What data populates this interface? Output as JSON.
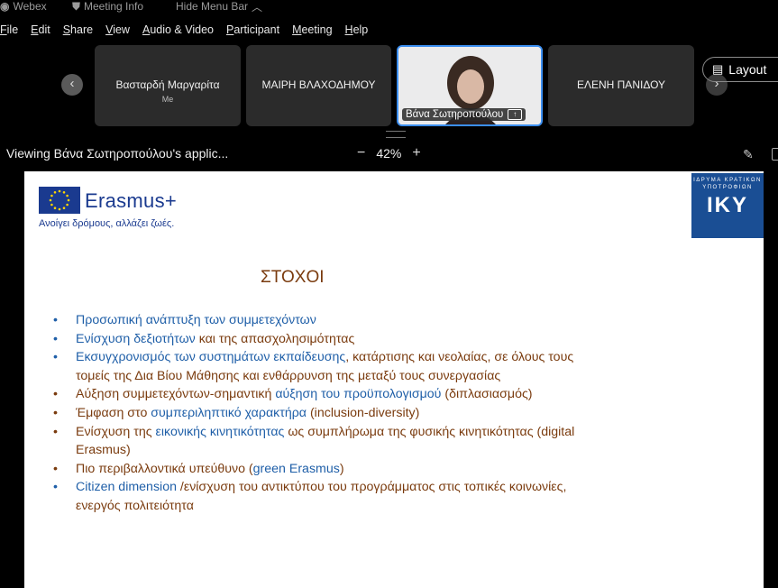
{
  "topbar": {
    "app_name": "Webex",
    "meeting_info": "Meeting Info",
    "hide_menu": "Hide Menu Bar"
  },
  "menu": [
    "File",
    "Edit",
    "Share",
    "View",
    "Audio & Video",
    "Participant",
    "Meeting",
    "Help"
  ],
  "participants": [
    {
      "name": "Βασταρδή Μαργαρίτα",
      "sub": "Me"
    },
    {
      "name": "ΜΑΙΡΗ ΒΛΑΧΟΔΗΜΟΥ"
    },
    {
      "name": "Βάνα Σωτηροπούλου",
      "active": true
    },
    {
      "name": "ΕΛΕΝΗ ΠΑΝΙΔΟΥ"
    }
  ],
  "layout_label": "Layout",
  "viewbar": {
    "viewing_text": "Viewing Βάνα Σωτηροπούλου's applic...",
    "zoom": "42%"
  },
  "slide": {
    "brand": "Erasmus+",
    "tagline": "Ανοίγει δρόμους, αλλάζει ζωές.",
    "iky_small": "ΙΔΡΥΜΑ ΚΡΑΤΙΚΩΝ ΥΠΟΤΡΟΦΙΩΝ",
    "iky_big": "ΙΚΥ",
    "title": "ΣΤΟΧΟΙ",
    "bullets": [
      {
        "bullet": "blue",
        "parts": [
          {
            "c": "b",
            "t": "Προσωπική ανάπτυξη των συμμετεχόντων"
          }
        ]
      },
      {
        "bullet": "blue",
        "parts": [
          {
            "c": "b",
            "t": "Ενίσχυση δεξιοτήτων "
          },
          {
            "c": "o",
            "t": "και της απασχολησιμότητας"
          }
        ]
      },
      {
        "bullet": "blue",
        "parts": [
          {
            "c": "b",
            "t": "Εκσυγχρονισμός των συστημάτων εκπαίδευσης"
          },
          {
            "c": "o",
            "t": ", κατάρτισης και νεολαίας, σε όλους τους τομείς της Δια Βίου Μάθησης και ενθάρρυνση της μεταξύ τους συνεργασίας"
          }
        ]
      },
      {
        "bullet": "brown",
        "parts": [
          {
            "c": "o",
            "t": "Αύξηση συμμετεχόντων-σημαντική "
          },
          {
            "c": "b",
            "t": "αύξηση του προϋπολογισμού"
          },
          {
            "c": "o",
            "t": " (διπλασιασμός)"
          }
        ]
      },
      {
        "bullet": "brown",
        "parts": [
          {
            "c": "o",
            "t": "Έμφαση στο "
          },
          {
            "c": "b",
            "t": "συμπεριληπτικό χαρακτήρα"
          },
          {
            "c": "o",
            "t": " (inclusion-diversity)"
          }
        ]
      },
      {
        "bullet": "brown",
        "parts": [
          {
            "c": "o",
            "t": "Ενίσχυση της "
          },
          {
            "c": "b",
            "t": "εικονικής κινητικότητας"
          },
          {
            "c": "o",
            "t": " ως συμπλήρωμα της φυσικής κινητικότητας (digital Erasmus)"
          }
        ]
      },
      {
        "bullet": "brown",
        "parts": [
          {
            "c": "o",
            "t": "Πιο περιβαλλοντικά υπεύθυνο ("
          },
          {
            "c": "b",
            "t": "green Erasmus"
          },
          {
            "c": "o",
            "t": ")"
          }
        ]
      },
      {
        "bullet": "blue",
        "parts": [
          {
            "c": "b",
            "t": "Citizen dimension "
          },
          {
            "c": "o",
            "t": "/ενίσχυση του αντικτύπου του προγράμματος στις τοπικές κοινωνίες, ενεργός πολιτειότητα"
          }
        ]
      }
    ]
  }
}
